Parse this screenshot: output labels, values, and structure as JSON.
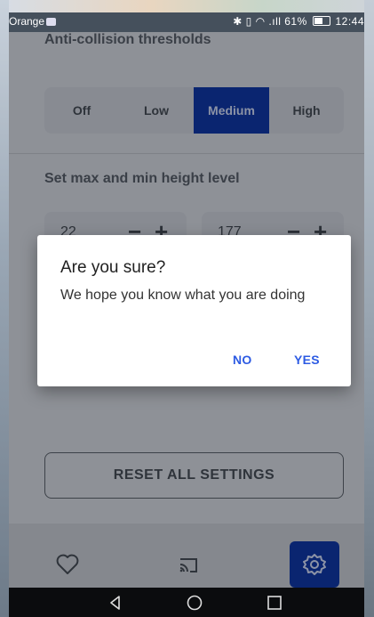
{
  "status_bar": {
    "carrier": "Orange",
    "battery": "61%",
    "time": "12:44"
  },
  "settings": {
    "collision_title": "Anti-collision thresholds",
    "collision_options": [
      "Off",
      "Low",
      "Medium",
      "High"
    ],
    "collision_selected": "Medium",
    "height_title": "Set max and min height level",
    "min_height": "22",
    "max_height": "177",
    "minus_symbol": "−",
    "plus_symbol": "+",
    "reset_label": "RESET ALL SETTINGS"
  },
  "dialog": {
    "title": "Are you sure?",
    "message": "We hope you know what you are doing",
    "no_label": "NO",
    "yes_label": "YES"
  },
  "tabs": [
    {
      "icon": "heart-icon"
    },
    {
      "icon": "cast-icon"
    },
    {
      "icon": "gear-icon",
      "active": true
    }
  ],
  "colors": {
    "accent": "#0a2570",
    "dialog_button": "#2d5be3",
    "scrim_background": "#8e9197"
  }
}
